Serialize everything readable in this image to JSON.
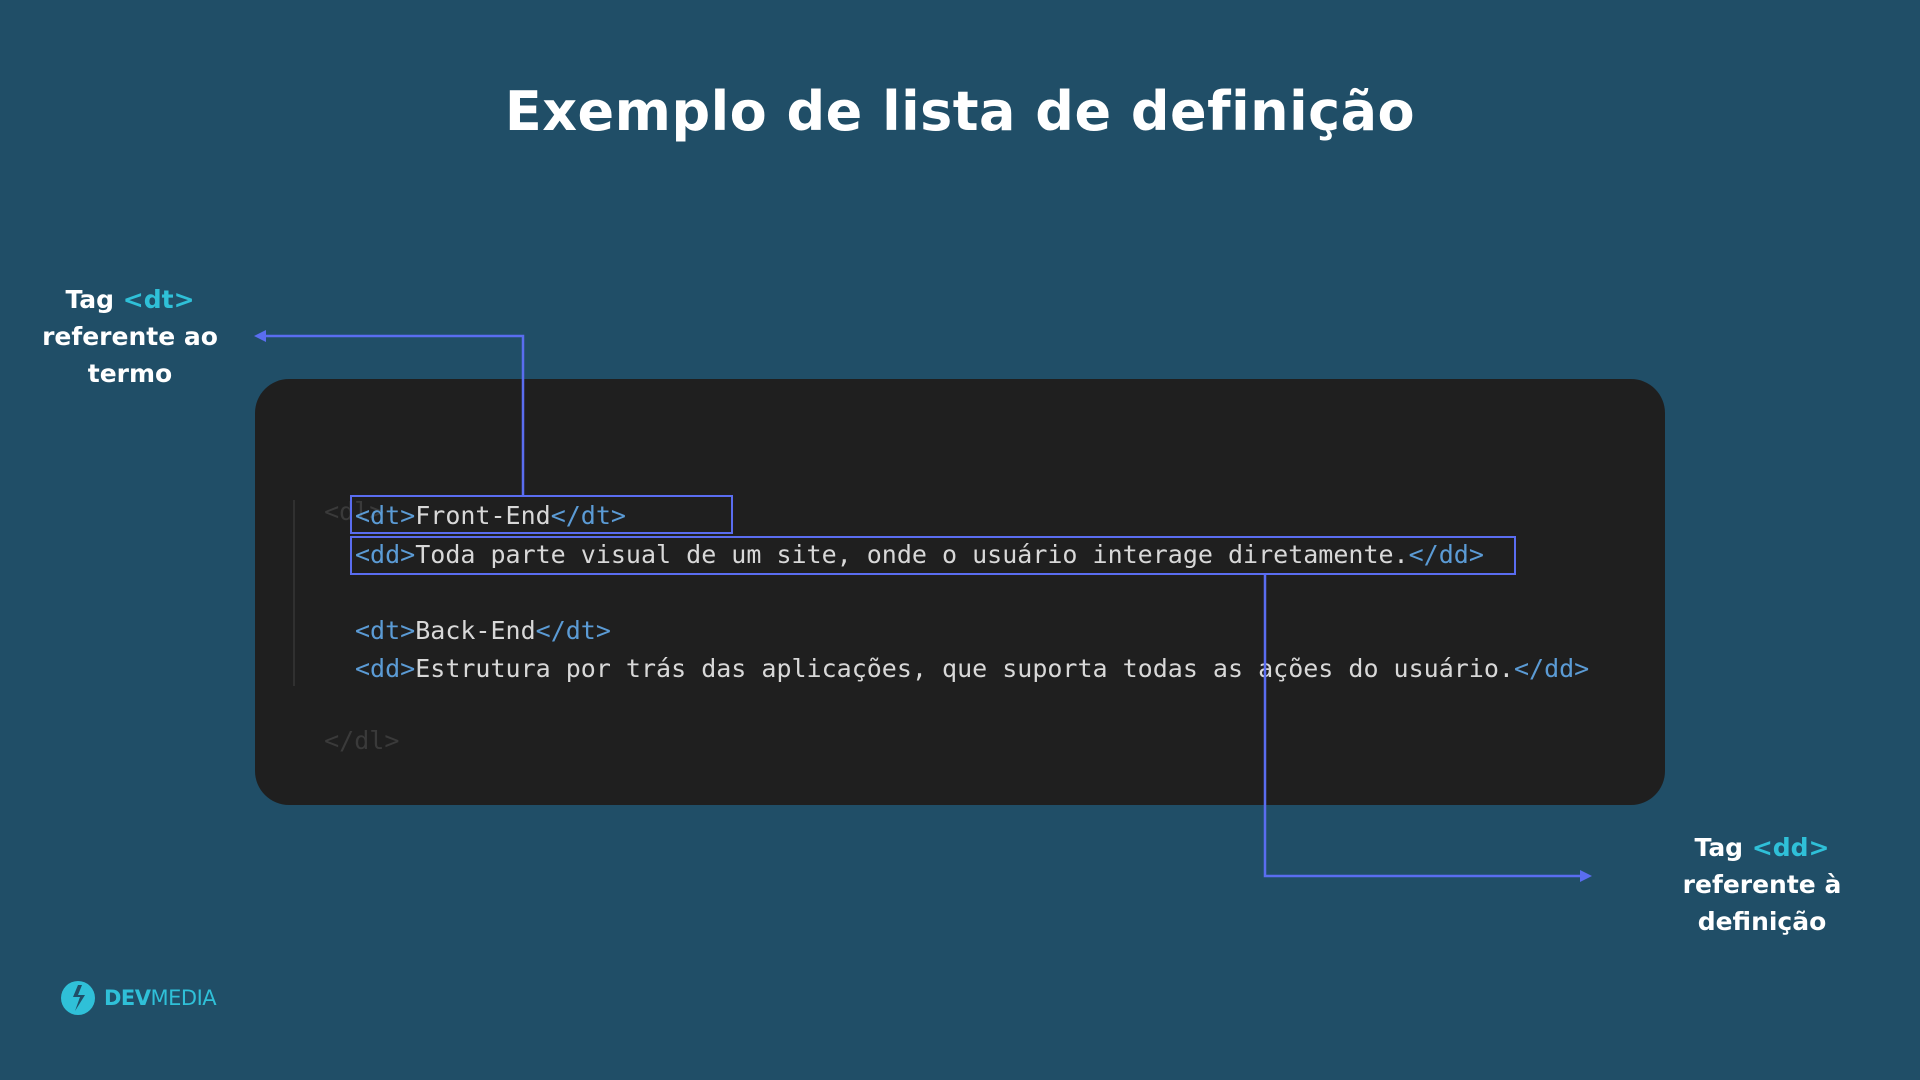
{
  "title": "Exemplo de lista de definição",
  "code": {
    "dl_open": "<dl>",
    "dl_close": "</dl>",
    "line1": {
      "open": "<dt>",
      "text": "Front-End",
      "close": "</dt>"
    },
    "line2": {
      "open": "<dd>",
      "text": "Toda parte visual de um site, onde o usuário interage diretamente.",
      "close": "</dd>"
    },
    "line3": {
      "open": "<dt>",
      "text": "Back-End",
      "close": "</dt>"
    },
    "line4": {
      "open": "<dd>",
      "text": "Estrutura por trás das aplicações, que suporta todas as ações do usuário.",
      "close": "</dd>"
    }
  },
  "annotations": {
    "dt": {
      "prefix": "Tag",
      "tag": "<dt>",
      "line2": "referente ao",
      "line3": "termo"
    },
    "dd": {
      "prefix": "Tag",
      "tag": "<dd>",
      "line2": "referente à",
      "line3": "definição"
    }
  },
  "logo": {
    "bold": "DEV",
    "regular": "MEDIA"
  },
  "colors": {
    "background": "#204e67",
    "card": "#1f1f1f",
    "highlight": "#5a6df0",
    "accent": "#2fc0d8",
    "tag": "#5b9bd5"
  }
}
